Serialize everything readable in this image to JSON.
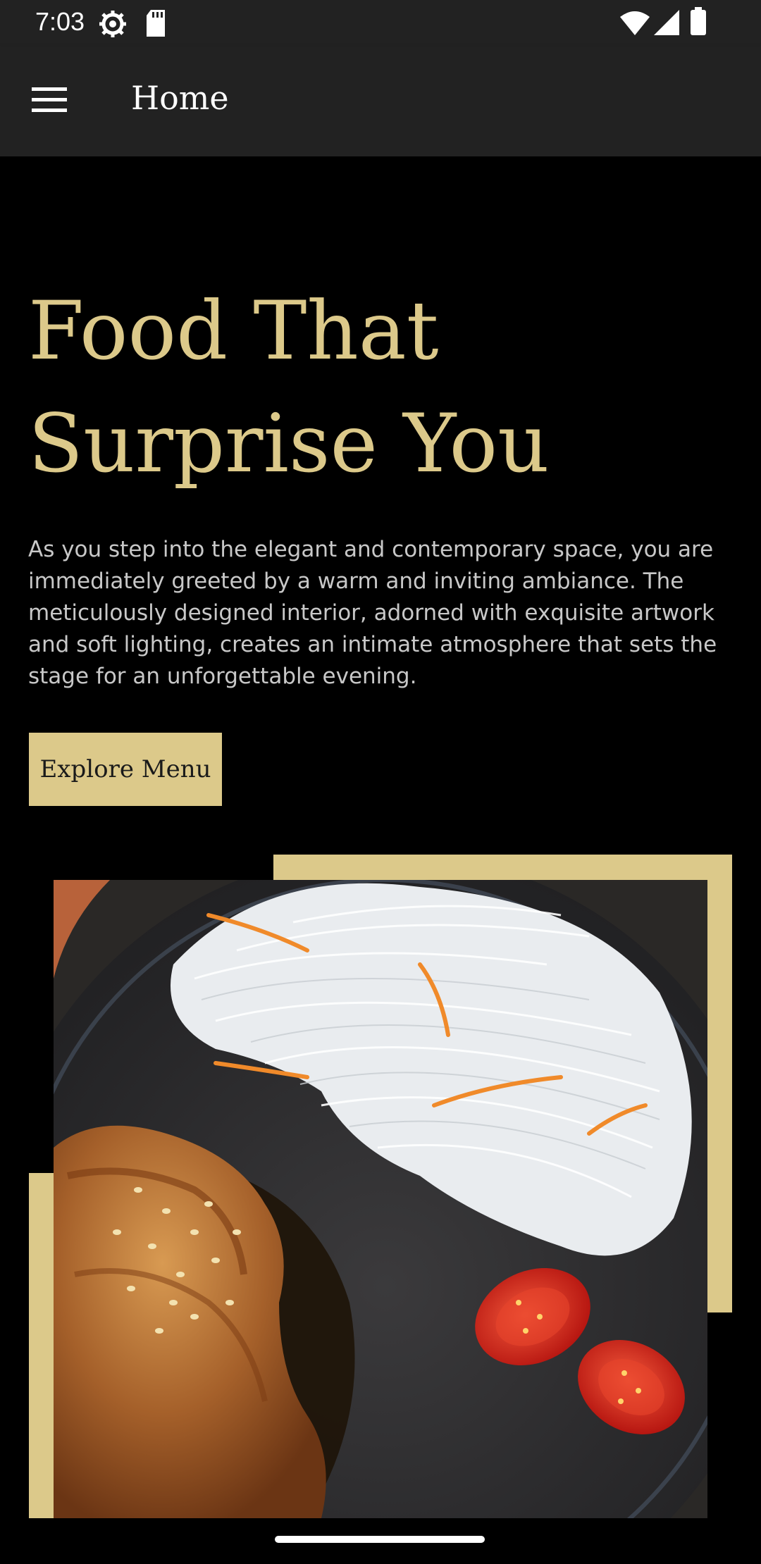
{
  "status_bar": {
    "time": "7:03",
    "left_icons": [
      "settings-gear-icon",
      "sd-card-icon"
    ],
    "right_icons": [
      "wifi-icon",
      "signal-icon",
      "battery-icon"
    ]
  },
  "app_bar": {
    "menu_icon": "hamburger-menu-icon",
    "title": "Home"
  },
  "hero": {
    "title": "Food That Surprise You",
    "body": "As you step into the elegant and contemporary space, you are immediately greeted by a warm and inviting ambiance. The meticulously designed interior, adorned with exquisite artwork and soft lighting, creates an intimate atmosphere that sets the stage for an unforgettable evening.",
    "button_label": "Explore Menu"
  },
  "colors": {
    "accent": "#dcc98a",
    "background": "#000000",
    "app_bar": "#222222",
    "body_text": "#c8c8c8"
  }
}
